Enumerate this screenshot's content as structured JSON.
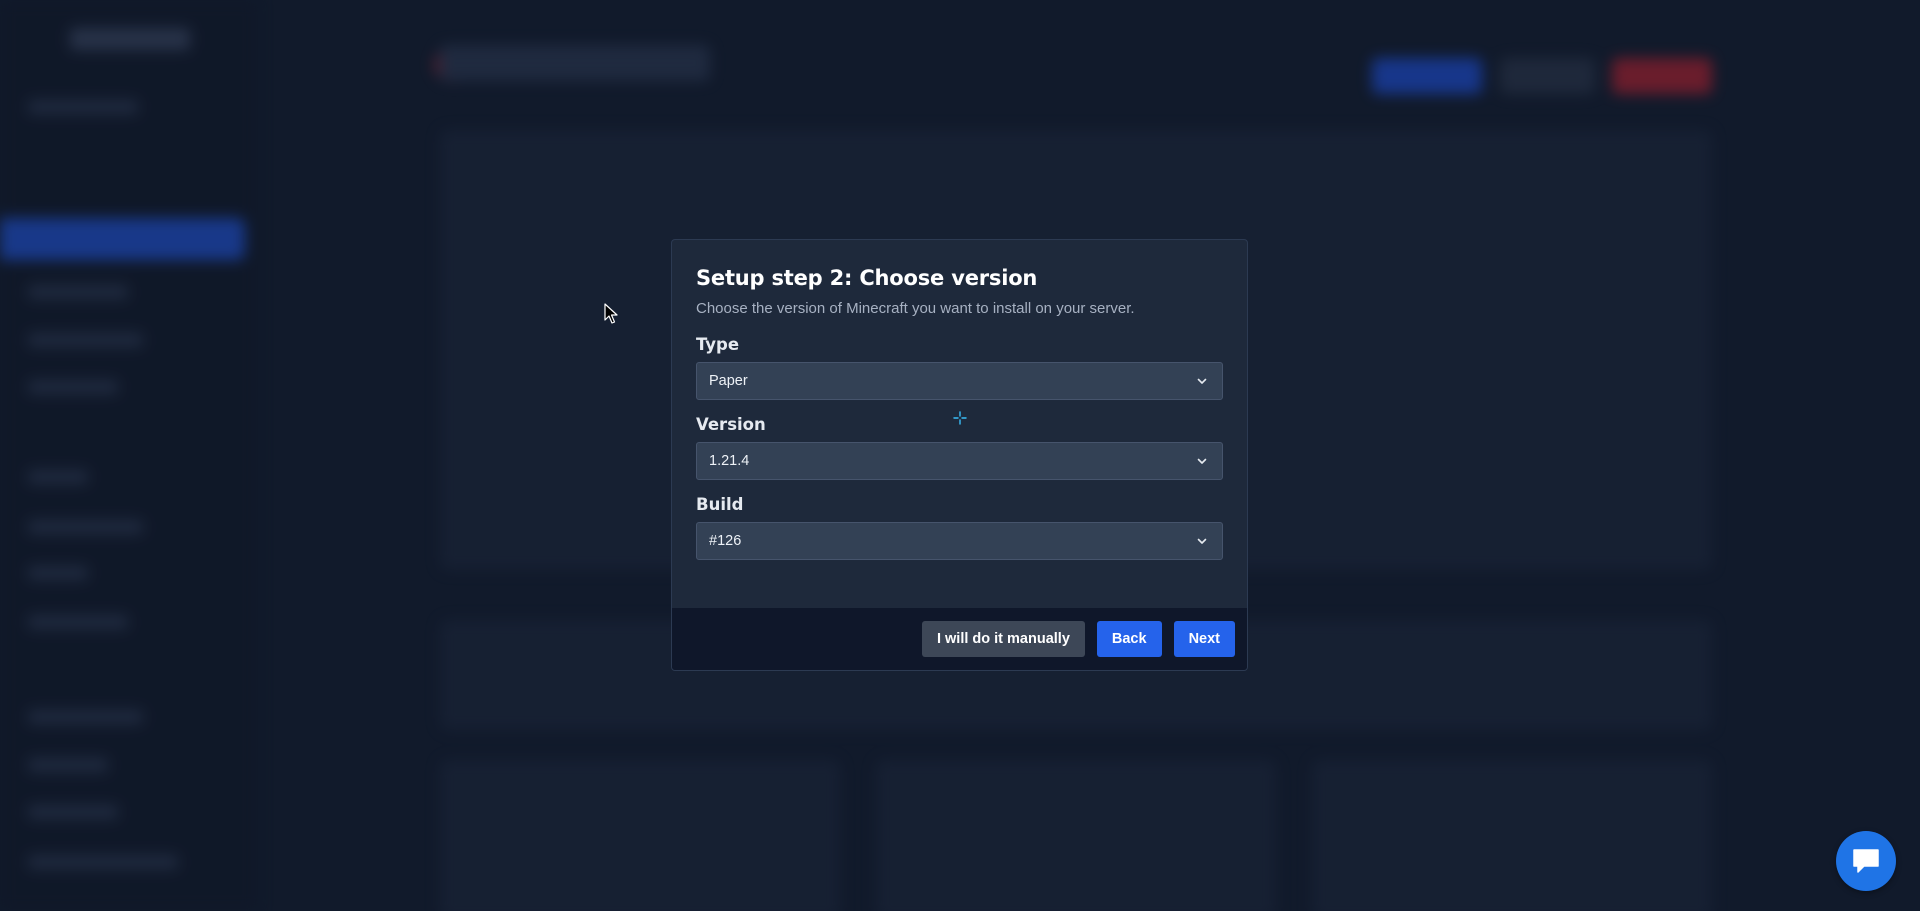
{
  "modal": {
    "title": "Setup step 2: Choose version",
    "description": "Choose the version of Minecraft you want to install on your server.",
    "fields": [
      {
        "label": "Type",
        "value": "Paper"
      },
      {
        "label": "Version",
        "value": "1.21.4"
      },
      {
        "label": "Build",
        "value": "#126"
      }
    ],
    "buttons": {
      "manual": "I will do it manually",
      "back": "Back",
      "next": "Next"
    }
  },
  "colors": {
    "accent": "#2563eb",
    "chat": "#1f74e6"
  },
  "icons": {
    "select_arrow": "chevron-down-icon",
    "chat": "chat-bubble-icon",
    "cursor": "mouse-pointer-icon",
    "crosshair": "crosshair-icon"
  }
}
